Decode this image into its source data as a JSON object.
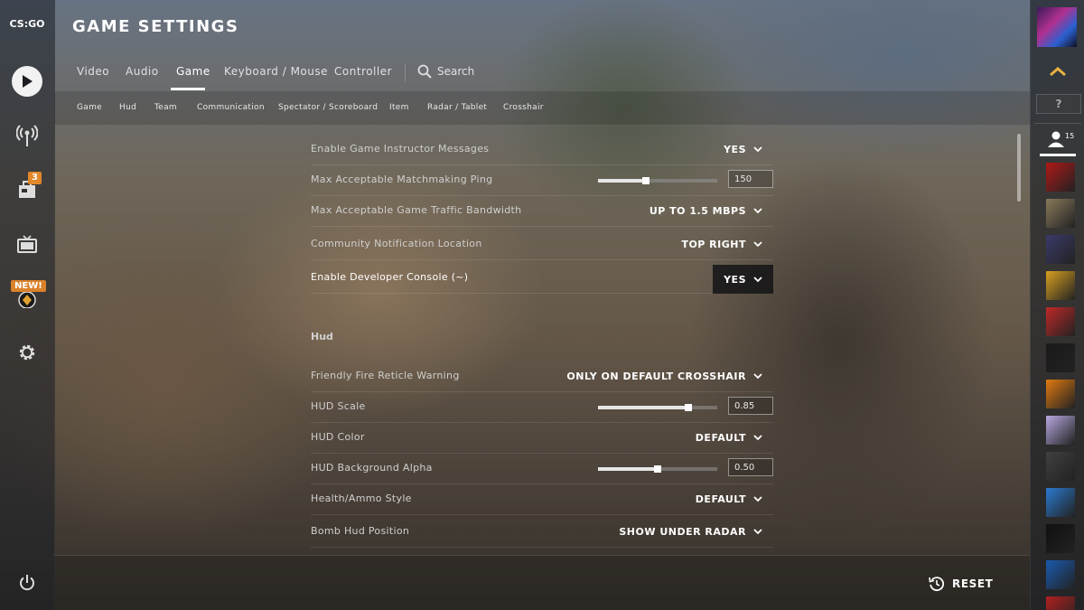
{
  "app": {
    "logo": "CS:GO",
    "title": "GAME SETTINGS"
  },
  "leftnav": {
    "items": [
      {
        "name": "play",
        "icon": "play-icon"
      },
      {
        "name": "watch",
        "icon": "antenna-icon"
      },
      {
        "name": "inventory",
        "icon": "inventory-icon",
        "badge": "3"
      },
      {
        "name": "tv",
        "icon": "tv-icon"
      },
      {
        "name": "operation",
        "icon": "operation-coin-icon",
        "badge": "NEW!"
      },
      {
        "name": "settings",
        "icon": "gear-icon"
      },
      {
        "name": "power",
        "icon": "power-icon"
      }
    ]
  },
  "tabs": {
    "items": [
      "Video",
      "Audio",
      "Game",
      "Keyboard / Mouse",
      "Controller"
    ],
    "active": "Game",
    "search_label": "Search"
  },
  "subtabs": [
    "Game",
    "Hud",
    "Team",
    "Communication",
    "Spectator / Scoreboard",
    "Item",
    "Radar / Tablet",
    "Crosshair"
  ],
  "settings": {
    "game_rows": [
      {
        "label": "Enable Game Instructor Messages",
        "type": "dropdown",
        "value": "YES"
      },
      {
        "label": "Max Acceptable Matchmaking Ping",
        "type": "slider",
        "value": "150",
        "fraction": 0.4
      },
      {
        "label": "Max Acceptable Game Traffic Bandwidth",
        "type": "dropdown",
        "value": "UP TO 1.5 MBPS"
      },
      {
        "label": "Community Notification Location",
        "type": "dropdown",
        "value": "TOP RIGHT"
      },
      {
        "label": "Enable Developer Console (~)",
        "type": "dropdown",
        "value": "YES",
        "highlighted": true
      }
    ],
    "hud_section_title": "Hud",
    "hud_rows": [
      {
        "label": "Friendly Fire Reticle Warning",
        "type": "dropdown",
        "value": "ONLY ON DEFAULT CROSSHAIR"
      },
      {
        "label": "HUD Scale",
        "type": "slider",
        "value": "0.85",
        "fraction": 0.76
      },
      {
        "label": "HUD Color",
        "type": "dropdown",
        "value": "DEFAULT"
      },
      {
        "label": "HUD Background Alpha",
        "type": "slider",
        "value": "0.50",
        "fraction": 0.5
      },
      {
        "label": "Health/Ammo Style",
        "type": "dropdown",
        "value": "DEFAULT"
      },
      {
        "label": "Bomb Hud Position",
        "type": "dropdown",
        "value": "SHOW UNDER RADAR"
      }
    ]
  },
  "footer": {
    "reset_label": "RESET"
  },
  "rightbar": {
    "rank_label": "?",
    "friends_count": "15",
    "avatar_colors": [
      "#b01818",
      "#8a7a5a",
      "#3a3a6a",
      "#d8a020",
      "#c02828",
      "#1a1a1a",
      "#e07a10",
      "#b8a8e0",
      "#404040",
      "#2a7ad0",
      "#101010",
      "#1a5ab0",
      "#b02020"
    ]
  },
  "colors": {
    "accent": "#ffffff",
    "badge": "#e2872a"
  }
}
